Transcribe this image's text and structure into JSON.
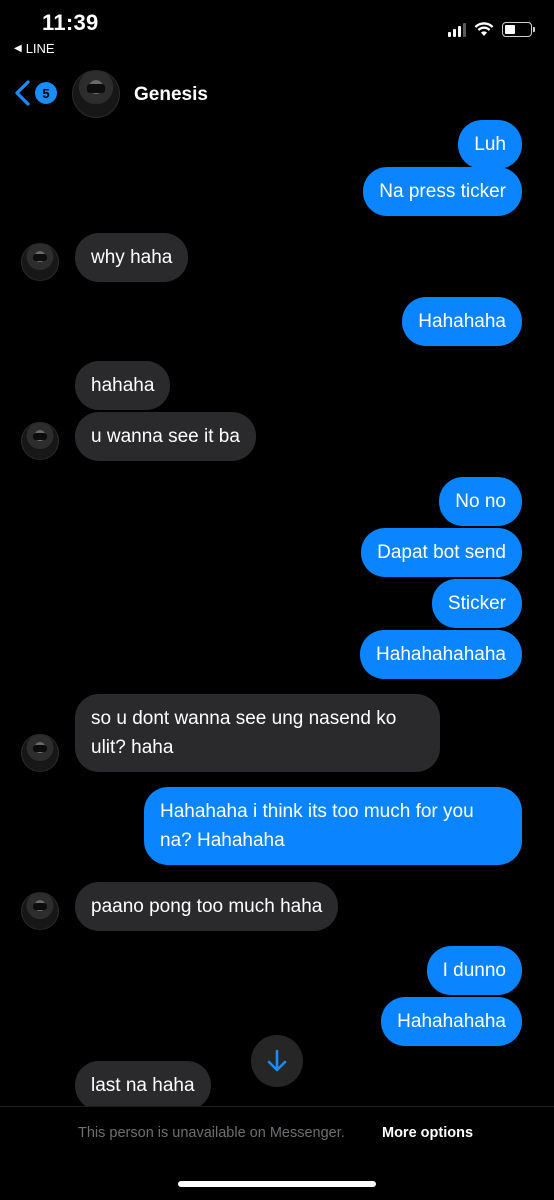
{
  "status_bar": {
    "time": "11:39",
    "back_app": "LINE"
  },
  "header": {
    "back_badge": "5",
    "contact_name": "Genesis"
  },
  "messages": [
    {
      "text": "Luh"
    },
    {
      "text": "Na press ticker"
    },
    {
      "text": "why haha"
    },
    {
      "text": "Hahahaha"
    },
    {
      "text": "hahaha"
    },
    {
      "text": "u wanna see it ba"
    },
    {
      "text": "No no"
    },
    {
      "text": "Dapat bot send"
    },
    {
      "text": "Sticker"
    },
    {
      "text": "Hahahahahaha"
    },
    {
      "text": "so u dont wanna see ung nasend ko ulit? haha"
    },
    {
      "text": "Hahahaha i think its too much for you na? Hahahaha"
    },
    {
      "text": "paano pong too much haha"
    },
    {
      "text": "I dunno"
    },
    {
      "text": "Hahahahaha"
    },
    {
      "text": "last na haha"
    }
  ],
  "footer": {
    "notice": "This person is unavailable on Messenger.",
    "more_options": "More options"
  },
  "colors": {
    "outgoing_bubble": "#0a84ff",
    "incoming_bubble": "#2a2a2c",
    "badge": "#1a8cff"
  }
}
